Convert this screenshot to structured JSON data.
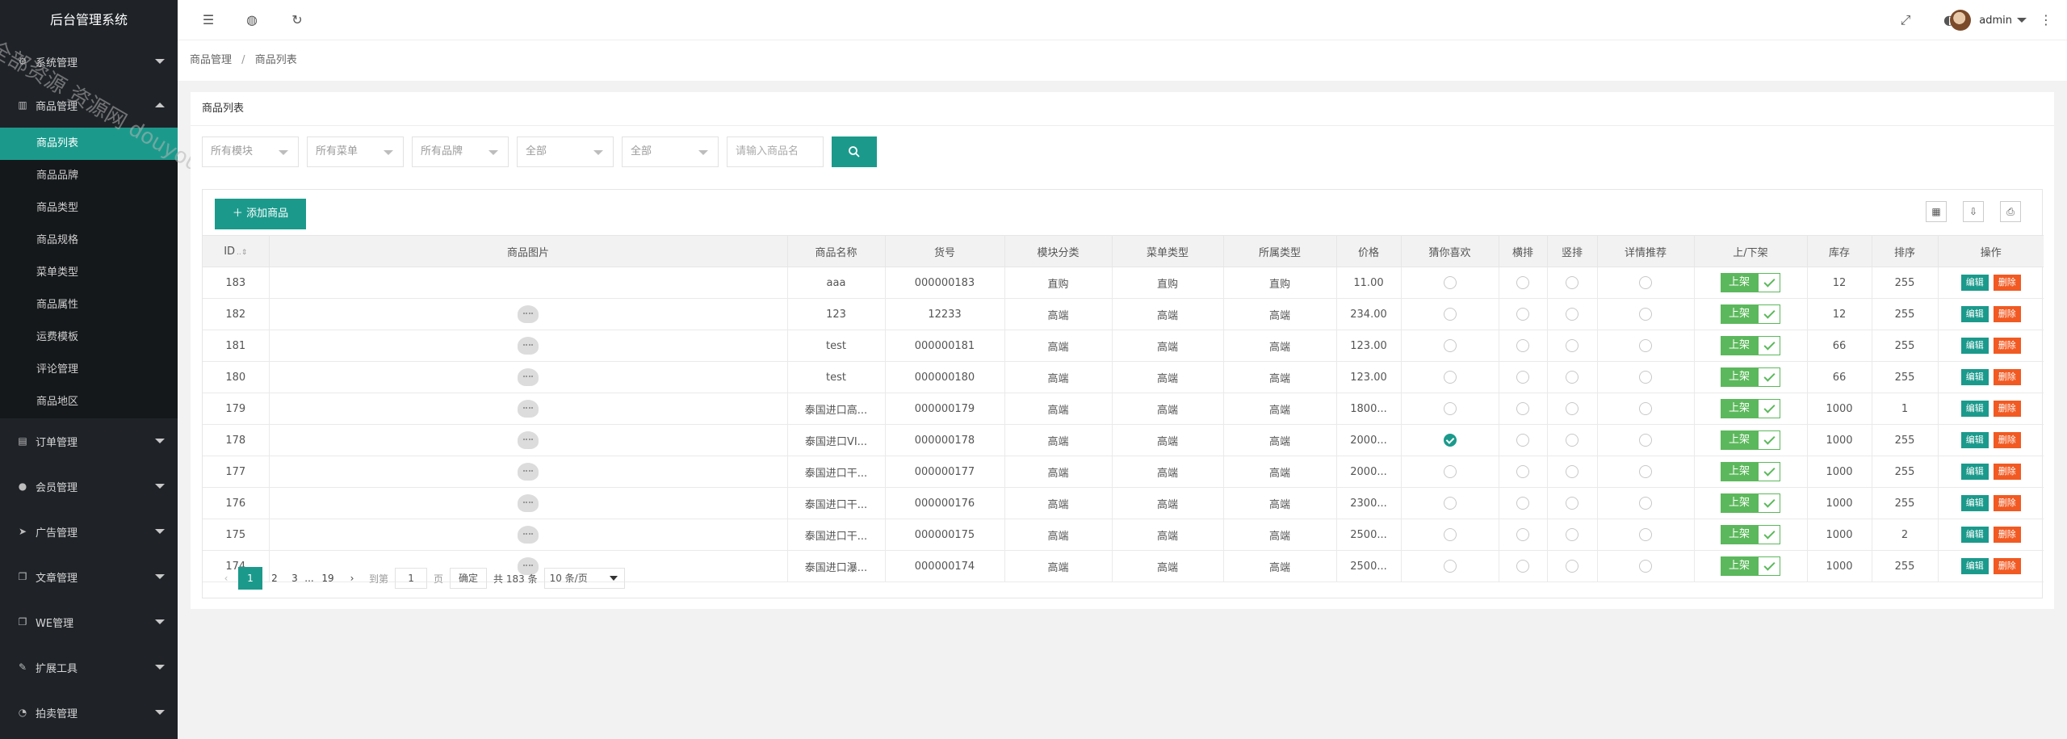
{
  "app": {
    "title": "后台管理系统"
  },
  "sidebar": {
    "groups": [
      {
        "label": "系统管理"
      },
      {
        "label": "商品管理"
      },
      {
        "label": "订单管理"
      },
      {
        "label": "会员管理"
      },
      {
        "label": "广告管理"
      },
      {
        "label": "文章管理"
      },
      {
        "label": "WE管理"
      },
      {
        "label": "扩展工具"
      },
      {
        "label": "拍卖管理"
      }
    ],
    "sub_items": [
      "商品列表",
      "商品品牌",
      "商品类型",
      "商品规格",
      "菜单类型",
      "商品属性",
      "运费模板",
      "评论管理",
      "商品地区"
    ]
  },
  "header": {
    "username": "admin"
  },
  "breadcrumb": {
    "parent": "商品管理",
    "sep": "/",
    "current": "商品列表"
  },
  "card": {
    "title": "商品列表"
  },
  "filters": {
    "selects": [
      "所有模块",
      "所有菜单",
      "所有品牌",
      "全部",
      "全部"
    ],
    "search_placeholder": "请输入商品名"
  },
  "toolbar": {
    "add_label": "添加商品"
  },
  "table": {
    "headers": [
      "ID",
      "商品图片",
      "商品名称",
      "货号",
      "模块分类",
      "菜单类型",
      "所属类型",
      "价格",
      "猜你喜欢",
      "横排",
      "竖排",
      "详情推荐",
      "上/下架",
      "库存",
      "排序",
      "操作"
    ],
    "on_shelf_label": "上架",
    "edit_label": "编辑",
    "delete_label": "删除",
    "rows": [
      {
        "id": "183",
        "has_pic": false,
        "name": "aaa",
        "sku": "000000183",
        "module": "直购",
        "menu": "直购",
        "type": "直购",
        "price": "11.00",
        "like": false,
        "hrow": false,
        "vrow": false,
        "detail": false,
        "stock": "12",
        "sort": "255"
      },
      {
        "id": "182",
        "has_pic": true,
        "name": "123",
        "sku": "12233",
        "module": "高端",
        "menu": "高端",
        "type": "高端",
        "price": "234.00",
        "like": false,
        "hrow": false,
        "vrow": false,
        "detail": false,
        "stock": "12",
        "sort": "255"
      },
      {
        "id": "181",
        "has_pic": true,
        "name": "test",
        "sku": "000000181",
        "module": "高端",
        "menu": "高端",
        "type": "高端",
        "price": "123.00",
        "like": false,
        "hrow": false,
        "vrow": false,
        "detail": false,
        "stock": "66",
        "sort": "255"
      },
      {
        "id": "180",
        "has_pic": true,
        "name": "test",
        "sku": "000000180",
        "module": "高端",
        "menu": "高端",
        "type": "高端",
        "price": "123.00",
        "like": false,
        "hrow": false,
        "vrow": false,
        "detail": false,
        "stock": "66",
        "sort": "255"
      },
      {
        "id": "179",
        "has_pic": true,
        "name": "泰国进口高...",
        "sku": "000000179",
        "module": "高端",
        "menu": "高端",
        "type": "高端",
        "price": "1800...",
        "like": false,
        "hrow": false,
        "vrow": false,
        "detail": false,
        "stock": "1000",
        "sort": "1"
      },
      {
        "id": "178",
        "has_pic": true,
        "name": "泰国进口VI...",
        "sku": "000000178",
        "module": "高端",
        "menu": "高端",
        "type": "高端",
        "price": "2000...",
        "like": true,
        "hrow": false,
        "vrow": false,
        "detail": false,
        "stock": "1000",
        "sort": "255"
      },
      {
        "id": "177",
        "has_pic": true,
        "name": "泰国进口干...",
        "sku": "000000177",
        "module": "高端",
        "menu": "高端",
        "type": "高端",
        "price": "2000...",
        "like": false,
        "hrow": false,
        "vrow": false,
        "detail": false,
        "stock": "1000",
        "sort": "255"
      },
      {
        "id": "176",
        "has_pic": true,
        "name": "泰国进口干...",
        "sku": "000000176",
        "module": "高端",
        "menu": "高端",
        "type": "高端",
        "price": "2300...",
        "like": false,
        "hrow": false,
        "vrow": false,
        "detail": false,
        "stock": "1000",
        "sort": "255"
      },
      {
        "id": "175",
        "has_pic": true,
        "name": "泰国进口干...",
        "sku": "000000175",
        "module": "高端",
        "menu": "高端",
        "type": "高端",
        "price": "2500...",
        "like": false,
        "hrow": false,
        "vrow": false,
        "detail": false,
        "stock": "1000",
        "sort": "2"
      },
      {
        "id": "174",
        "has_pic": true,
        "name": "泰国进口瀑...",
        "sku": "000000174",
        "module": "高端",
        "menu": "高端",
        "type": "高端",
        "price": "2500...",
        "like": false,
        "hrow": false,
        "vrow": false,
        "detail": false,
        "stock": "1000",
        "sort": "255"
      }
    ]
  },
  "pagination": {
    "pages": [
      "1",
      "2",
      "3",
      "...",
      "19"
    ],
    "current": "1",
    "goto_label": "到第",
    "page_unit": "页",
    "goto_value": "1",
    "confirm_label": "确定",
    "total_text": "共 183 条",
    "page_size": "10 条/页"
  },
  "watermark": {
    "text": "全部资源 资源网 douyouvip.com"
  },
  "colors": {
    "primary": "#1b9a8c",
    "sidebar_bg": "#1f2328",
    "on_shelf": "#5cb85c",
    "delete": "#f15a22"
  }
}
